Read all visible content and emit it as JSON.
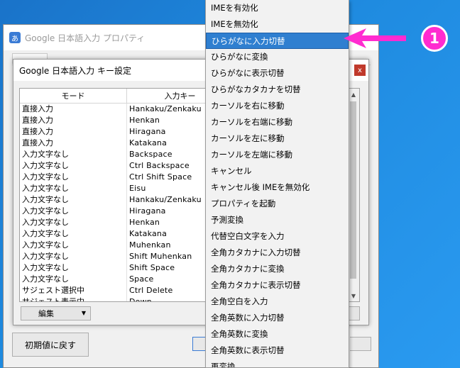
{
  "outer_window": {
    "title": "Google 日本語入力 プロパティ",
    "app_icon_glyph": "あ",
    "reset_button": "初期値に戻す"
  },
  "inner_window": {
    "title": "Google 日本語入力 キー設定",
    "close_glyph": "x",
    "columns": [
      "モード",
      "入力キー"
    ],
    "rows": [
      [
        "直接入力",
        "Hankaku/Zenkaku"
      ],
      [
        "直接入力",
        "Henkan"
      ],
      [
        "直接入力",
        "Hiragana"
      ],
      [
        "直接入力",
        "Katakana"
      ],
      [
        "入力文字なし",
        "Backspace"
      ],
      [
        "入力文字なし",
        "Ctrl Backspace"
      ],
      [
        "入力文字なし",
        "Ctrl Shift Space"
      ],
      [
        "入力文字なし",
        "Eisu"
      ],
      [
        "入力文字なし",
        "Hankaku/Zenkaku"
      ],
      [
        "入力文字なし",
        "Hiragana"
      ],
      [
        "入力文字なし",
        "Henkan"
      ],
      [
        "入力文字なし",
        "Katakana"
      ],
      [
        "入力文字なし",
        "Muhenkan"
      ],
      [
        "入力文字なし",
        "Shift Muhenkan"
      ],
      [
        "入力文字なし",
        "Shift Space"
      ],
      [
        "入力文字なし",
        "Space"
      ],
      [
        "サジェスト選択中",
        "Ctrl Delete"
      ],
      [
        "サジェスト表示中",
        "Down"
      ]
    ],
    "edit_button": "編集"
  },
  "dropdown_menu": {
    "items": [
      "IMEを有効化",
      "IMEを無効化",
      "ひらがなに入力切替",
      "ひらがなに変換",
      "ひらがなに表示切替",
      "ひらがなカタカナを切替",
      "カーソルを右に移動",
      "カーソルを右端に移動",
      "カーソルを左に移動",
      "カーソルを左端に移動",
      "キャンセル",
      "キャンセル後 IMEを無効化",
      "プロパティを起動",
      "予測変換",
      "代替空白文字を入力",
      "全角カタカナに入力切替",
      "全角カタカナに変換",
      "全角カタカナに表示切替",
      "全角空白を入力",
      "全角英数に入力切替",
      "全角英数に変換",
      "全角英数に表示切替",
      "再変換"
    ],
    "selected_index": 2
  },
  "annotation": {
    "badge_number": "1",
    "color": "#ff2bd0"
  }
}
